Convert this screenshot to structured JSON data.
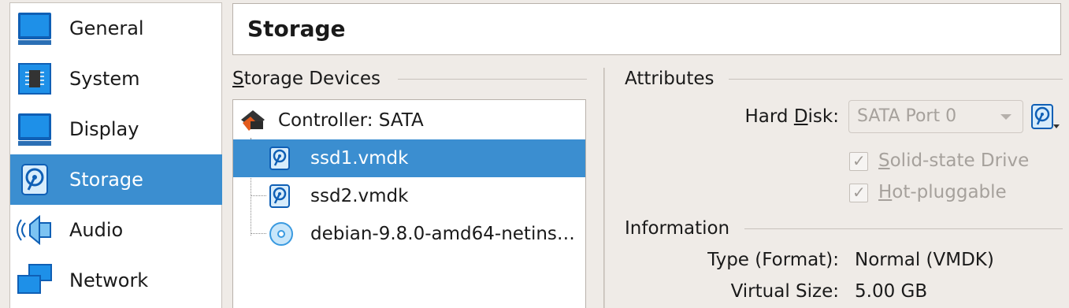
{
  "sidebar": {
    "items": [
      {
        "label": "General",
        "icon": "general-icon"
      },
      {
        "label": "System",
        "icon": "system-icon"
      },
      {
        "label": "Display",
        "icon": "display-icon"
      },
      {
        "label": "Storage",
        "icon": "storage-icon",
        "selected": true
      },
      {
        "label": "Audio",
        "icon": "audio-icon"
      },
      {
        "label": "Network",
        "icon": "network-icon"
      }
    ]
  },
  "header": {
    "title": "Storage"
  },
  "storage_devices": {
    "group_title_mnemonic": "S",
    "group_title_rest": "torage Devices",
    "tree": [
      {
        "label": "Controller: SATA",
        "icon": "controller-icon"
      },
      {
        "label": "ssd1.vmdk",
        "icon": "hard-disk-icon",
        "selected": true
      },
      {
        "label": "ssd2.vmdk",
        "icon": "hard-disk-icon"
      },
      {
        "label": "debian-9.8.0-amd64-netins…",
        "icon": "optical-disc-icon"
      }
    ]
  },
  "attributes": {
    "group_title": "Attributes",
    "hard_disk_label_pre": "Hard ",
    "hard_disk_label_mnemonic": "D",
    "hard_disk_label_post": "isk:",
    "hard_disk_value": "SATA Port 0",
    "solid_state_mnemonic": "S",
    "solid_state_rest": "olid-state Drive",
    "solid_state_checked": true,
    "hot_plug_mnemonic": "H",
    "hot_plug_rest": "ot-pluggable",
    "hot_plug_checked": true,
    "check_mark": "✓"
  },
  "information": {
    "group_title": "Information",
    "rows": [
      {
        "label": "Type (Format):",
        "value": "Normal (VMDK)"
      },
      {
        "label": "Virtual Size:",
        "value": "5.00 GB"
      }
    ]
  },
  "colors": {
    "selection": "#3b8ed0",
    "background": "#efebe7"
  }
}
